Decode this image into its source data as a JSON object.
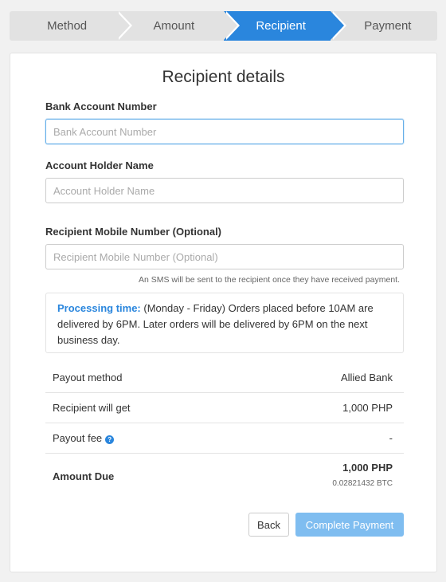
{
  "stepper": {
    "steps": [
      {
        "label": "Method",
        "active": false
      },
      {
        "label": "Amount",
        "active": false
      },
      {
        "label": "Recipient",
        "active": true
      },
      {
        "label": "Payment",
        "active": false
      }
    ]
  },
  "form": {
    "title": "Recipient details",
    "bank_account": {
      "label": "Bank Account Number",
      "placeholder": "Bank Account Number",
      "value": ""
    },
    "holder_name": {
      "label": "Account Holder Name",
      "placeholder": "Account Holder Name",
      "value": ""
    },
    "mobile": {
      "label": "Recipient Mobile Number (Optional)",
      "placeholder": "Recipient Mobile Number (Optional)",
      "value": ""
    },
    "mobile_helper": "An SMS will be sent to the recipient once they have received payment."
  },
  "info": {
    "heading": "Processing time:",
    "text": "(Monday - Friday) Orders placed before 10AM are delivered by 6PM. Later orders will be delivered by 6PM on the next business day."
  },
  "summary": {
    "payout_method": {
      "label": "Payout method",
      "value": "Allied Bank"
    },
    "recipient_gets": {
      "label": "Recipient will get",
      "value": "1,000 PHP"
    },
    "payout_fee": {
      "label": "Payout fee",
      "value": "-"
    },
    "amount_due": {
      "label": "Amount Due",
      "value": "1,000 PHP",
      "sub_value": "0.02821432 BTC"
    }
  },
  "buttons": {
    "back": "Back",
    "complete": "Complete Payment"
  },
  "colors": {
    "accent": "#2a86dd",
    "accent_disabled": "#7fbdf0"
  }
}
